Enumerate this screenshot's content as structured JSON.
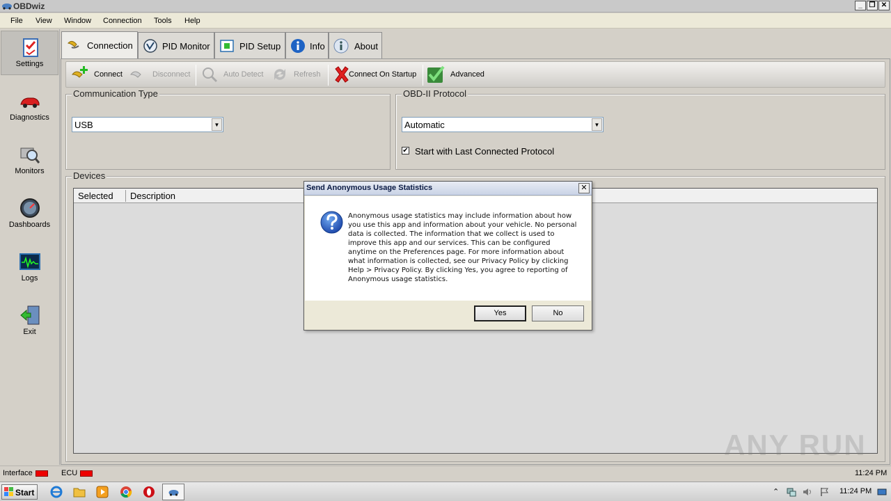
{
  "window": {
    "title": "OBDwiz",
    "controls": [
      "_",
      "❐",
      "✕"
    ]
  },
  "menu": {
    "items": [
      "File",
      "View",
      "Window",
      "Connection",
      "Tools",
      "Help"
    ]
  },
  "sidebar": {
    "items": [
      {
        "label": "Settings",
        "icon": "settings-checklist-icon",
        "active": true
      },
      {
        "label": "Diagnostics",
        "icon": "car-icon"
      },
      {
        "label": "Monitors",
        "icon": "magnifier-icon"
      },
      {
        "label": "Dashboards",
        "icon": "gauge-icon"
      },
      {
        "label": "Logs",
        "icon": "oscilloscope-icon"
      },
      {
        "label": "Exit",
        "icon": "exit-door-icon"
      }
    ]
  },
  "tabs": [
    {
      "label": "Connection",
      "icon": "plug-icon",
      "active": true
    },
    {
      "label": "PID Monitor",
      "icon": "pid-monitor-icon"
    },
    {
      "label": "PID Setup",
      "icon": "pid-setup-icon"
    },
    {
      "label": "Info",
      "icon": "info-icon"
    },
    {
      "label": "About",
      "icon": "about-icon"
    }
  ],
  "toolbar": {
    "connect": "Connect",
    "disconnect": "Disconnect",
    "auto_detect": "Auto Detect",
    "refresh": "Refresh",
    "connect_on_startup": "Connect On Startup",
    "advanced": "Advanced"
  },
  "communication": {
    "legend": "Communication Type",
    "value": "USB"
  },
  "protocol": {
    "legend": "OBD-II Protocol",
    "value": "Automatic",
    "checkbox_label": "Start with Last Connected Protocol",
    "checkbox_checked": true
  },
  "devices": {
    "legend": "Devices",
    "columns": [
      "Selected",
      "Description"
    ]
  },
  "status": {
    "interface": "Interface",
    "ecu": "ECU",
    "time": "11:24 PM",
    "led_color": "#ee0000"
  },
  "dialog": {
    "title": "Send Anonymous Usage Statistics",
    "message": "Anonymous usage statistics may include information about how you use this app and information about your vehicle. No personal data is collected. The information that we collect is used to improve this app and our services. This can be configured anytime on the Preferences page. For more information about what information is collected, see our Privacy Policy by clicking Help > Privacy Policy. By clicking Yes, you agree to reporting of Anonymous usage statistics.",
    "yes": "Yes",
    "no": "No",
    "close": "✕"
  },
  "taskbar": {
    "start": "Start",
    "apps": [
      "internet-explorer-icon",
      "folder-icon",
      "media-player-icon",
      "chrome-icon",
      "opera-icon",
      "obdwiz-app-icon"
    ],
    "clock": "11:24 PM"
  },
  "watermark": {
    "text": "ANY RUN"
  }
}
